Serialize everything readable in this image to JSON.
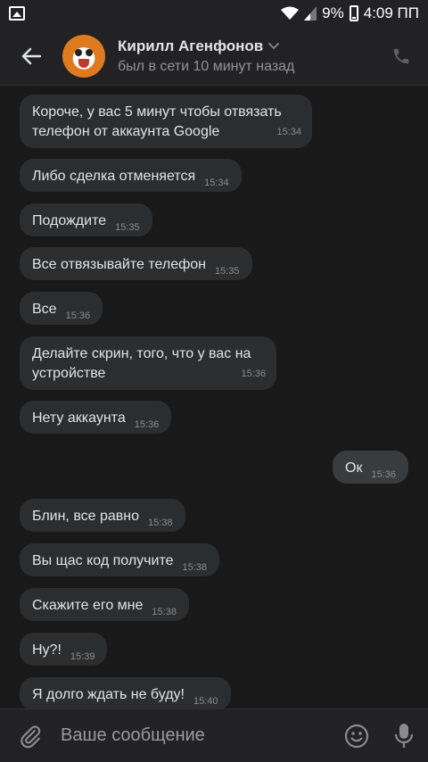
{
  "statusbar": {
    "battery": "9%",
    "time": "4:09 ПП"
  },
  "header": {
    "name": "Кирилл Агенфонов",
    "status": "был в сети 10 минут назад"
  },
  "messages": [
    {
      "text": "Короче, у вас 5 минут чтобы отвязать телефон от аккаунта Google",
      "time": "15:34",
      "dir": "in"
    },
    {
      "text": "Либо сделка отменяется",
      "time": "15:34",
      "dir": "in"
    },
    {
      "text": "Подождите",
      "time": "15:35",
      "dir": "in"
    },
    {
      "text": "Все отвязывайте телефон",
      "time": "15:35",
      "dir": "in"
    },
    {
      "text": "Все",
      "time": "15:36",
      "dir": "in"
    },
    {
      "text": "Делайте скрин, того, что у вас на устройстве",
      "time": "15:36",
      "dir": "in"
    },
    {
      "text": "Нету аккаунта",
      "time": "15:36",
      "dir": "in"
    },
    {
      "text": "Ок",
      "time": "15:36",
      "dir": "out"
    },
    {
      "text": "Блин, все равно",
      "time": "15:38",
      "dir": "in"
    },
    {
      "text": "Вы щас код получите",
      "time": "15:38",
      "dir": "in"
    },
    {
      "text": "Скажите его мне",
      "time": "15:38",
      "dir": "in"
    },
    {
      "text": "Ну?!",
      "time": "15:39",
      "dir": "in"
    },
    {
      "text": "Я долго ждать не буду!",
      "time": "15:40",
      "dir": "in"
    }
  ],
  "composer": {
    "placeholder": "Ваше сообщение"
  },
  "icons": {
    "back": "arrow-left-icon",
    "call": "phone-icon",
    "attach": "paperclip-icon",
    "emoji": "smile-icon",
    "mic": "microphone-icon"
  },
  "colors": {
    "background": "#19191a",
    "bubble": "#2c2d2e",
    "header": "#222224"
  }
}
